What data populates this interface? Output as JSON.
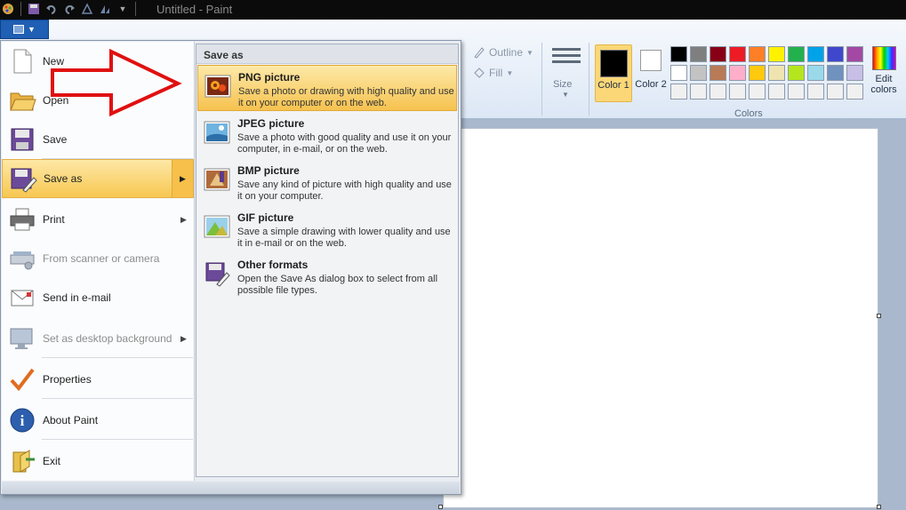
{
  "window": {
    "title": "Untitled - Paint"
  },
  "ribbon": {
    "outline_label": "Outline",
    "fill_label": "Fill",
    "size_label": "Size",
    "color1_label": "Color 1",
    "color2_label": "Color 2",
    "colors_group_label": "Colors",
    "edit_colors_label": "Edit colors",
    "color1_value": "#000000",
    "color2_value": "#ffffff",
    "palette": [
      "#000000",
      "#7f7f7f",
      "#880015",
      "#ed1c24",
      "#ff7f27",
      "#fff200",
      "#22b14c",
      "#00a2e8",
      "#3f48cc",
      "#a349a4",
      "#ffffff",
      "#c3c3c3",
      "#b97a57",
      "#ffaec9",
      "#ffc90e",
      "#efe4b0",
      "#b5e61d",
      "#99d9ea",
      "#7092be",
      "#c8bfe7",
      "#f0f0f0",
      "#f0f0f0",
      "#f0f0f0",
      "#f0f0f0",
      "#f0f0f0",
      "#f0f0f0",
      "#f0f0f0",
      "#f0f0f0",
      "#f0f0f0",
      "#f0f0f0"
    ]
  },
  "menu": {
    "items": [
      {
        "label": "New",
        "icon": "new-document-icon"
      },
      {
        "label": "Open",
        "icon": "open-folder-icon"
      },
      {
        "label": "Save",
        "icon": "floppy-disk-icon"
      },
      {
        "label": "Save as",
        "icon": "save-as-icon",
        "active": true
      },
      {
        "label": "Print",
        "icon": "printer-icon"
      },
      {
        "label": "From scanner or camera",
        "icon": "scanner-icon",
        "disabled": true
      },
      {
        "label": "Send in e-mail",
        "icon": "email-icon"
      },
      {
        "label": "Set as desktop background",
        "icon": "desktop-icon",
        "disabled": true
      },
      {
        "label": "Properties",
        "icon": "checkmark-icon"
      },
      {
        "label": "About Paint",
        "icon": "info-icon"
      },
      {
        "label": "Exit",
        "icon": "exit-icon"
      }
    ]
  },
  "save_as": {
    "header": "Save as",
    "options": [
      {
        "title": "PNG picture",
        "description": "Save a photo or drawing with high quality and use it on your computer or on the web.",
        "icon": "png-picture-icon"
      },
      {
        "title": "JPEG picture",
        "description": "Save a photo with good quality and use it on your computer, in e-mail, or on the web.",
        "icon": "jpeg-picture-icon"
      },
      {
        "title": "BMP picture",
        "description": "Save any kind of picture with high quality and use it on your computer.",
        "icon": "bmp-picture-icon"
      },
      {
        "title": "GIF picture",
        "description": "Save a simple drawing with lower quality and use it in e-mail or on the web.",
        "icon": "gif-picture-icon"
      },
      {
        "title": "Other formats",
        "description": "Open the Save As dialog box to select from all possible file types.",
        "icon": "other-formats-icon"
      }
    ]
  }
}
